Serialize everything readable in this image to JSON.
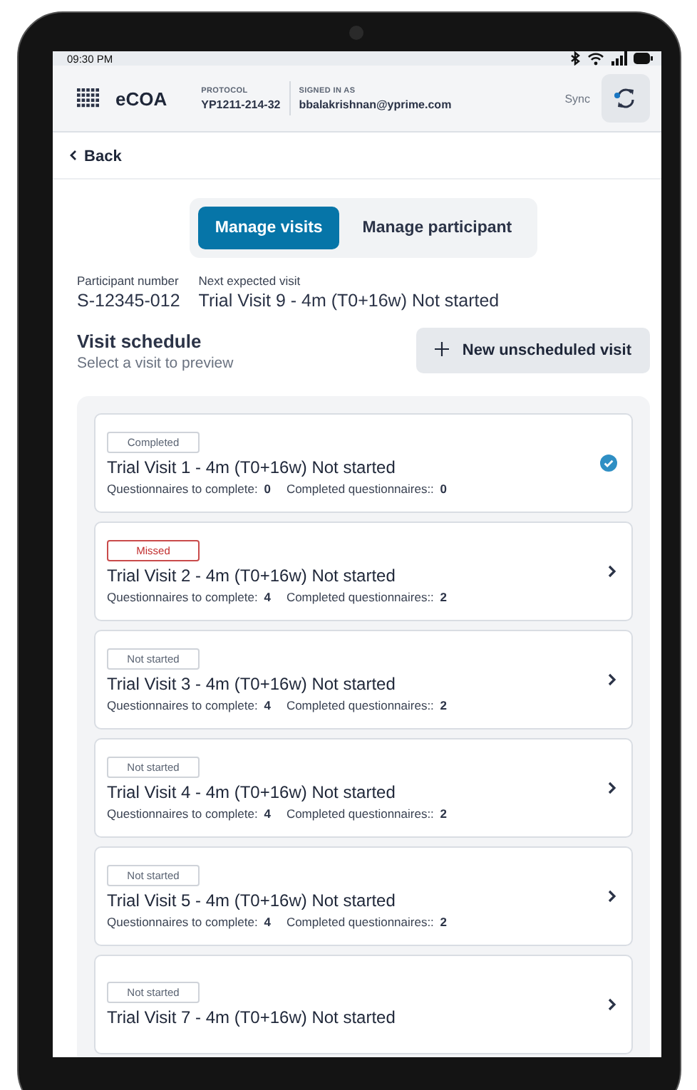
{
  "status_bar": {
    "time": "09:30 PM"
  },
  "header": {
    "app_name": "eCOA",
    "protocol": {
      "label": "PROTOCOL",
      "value": "YP1211-214-32"
    },
    "signed_in": {
      "label": "SIGNED IN AS",
      "value": "bbalakrishnan@yprime.com"
    },
    "sync": {
      "label": "Sync",
      "pending": true
    }
  },
  "back": "Back",
  "tabs": [
    {
      "label": "Manage visits",
      "selected": true
    },
    {
      "label": "Manage participant",
      "selected": false
    }
  ],
  "participant": {
    "number_label": "Participant number",
    "number": "S-12345-012",
    "next_label": "Next expected visit",
    "next": "Trial Visit 9 - 4m (T0+16w) Not started"
  },
  "schedule": {
    "title": "Visit schedule",
    "subtitle": "Select a visit to preview",
    "new_button": "New unscheduled visit"
  },
  "visits": [
    {
      "status": "Completed",
      "kind": "completed",
      "title": "Trial Visit 1 - 4m (T0+16w) Not started",
      "to_complete_label": "Questionnaires to complete:",
      "to_complete": "0",
      "completed_label": "Completed questionnaires::",
      "completed": "0"
    },
    {
      "status": "Missed",
      "kind": "missed",
      "title": "Trial Visit 2 - 4m (T0+16w) Not started",
      "to_complete_label": "Questionnaires to complete:",
      "to_complete": "4",
      "completed_label": "Completed questionnaires::",
      "completed": "2"
    },
    {
      "status": "Not started",
      "kind": "not_started",
      "title": "Trial Visit 3 - 4m (T0+16w) Not started",
      "to_complete_label": "Questionnaires to complete:",
      "to_complete": "4",
      "completed_label": "Completed questionnaires::",
      "completed": "2"
    },
    {
      "status": "Not started",
      "kind": "not_started",
      "title": "Trial Visit 4 - 4m (T0+16w) Not started",
      "to_complete_label": "Questionnaires to complete:",
      "to_complete": "4",
      "completed_label": "Completed questionnaires::",
      "completed": "2"
    },
    {
      "status": "Not started",
      "kind": "not_started",
      "title": "Trial Visit 5 - 4m (T0+16w) Not started",
      "to_complete_label": "Questionnaires to complete:",
      "to_complete": "4",
      "completed_label": "Completed questionnaires::",
      "completed": "2"
    },
    {
      "status": "Not started",
      "kind": "not_started",
      "title": "Trial Visit 7 - 4m (T0+16w) Not started"
    }
  ]
}
